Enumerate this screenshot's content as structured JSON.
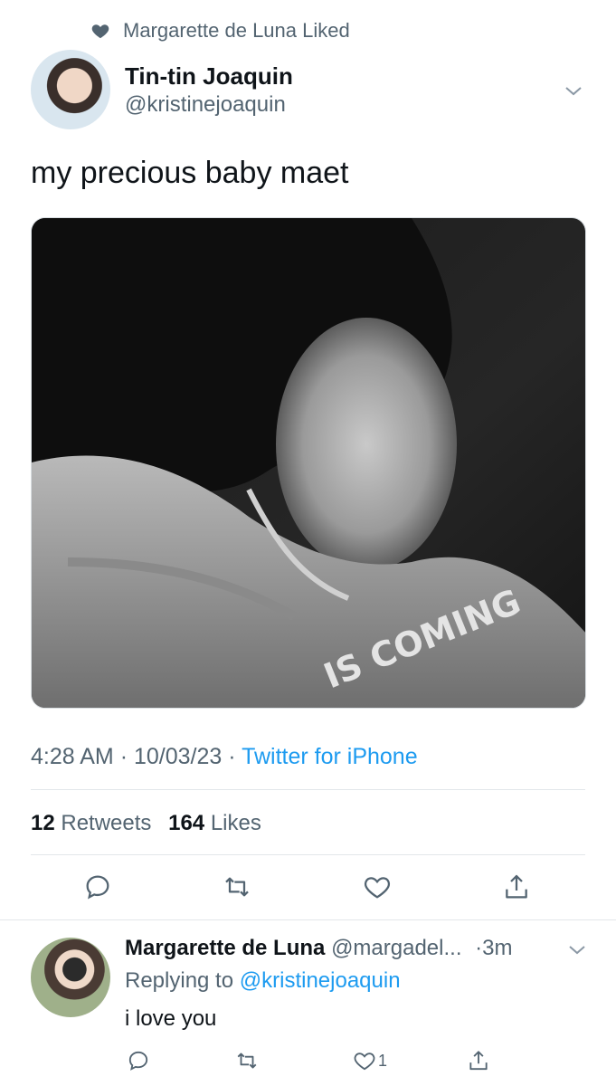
{
  "social_context": {
    "text": "Margarette de Luna Liked",
    "icon": "heart-icon"
  },
  "tweet": {
    "author_name": "Tin-tin Joaquin",
    "author_handle": "@kristinejoaquin",
    "text": "my precious baby maet",
    "media_caption": "IS COMING",
    "time": "4:28 AM",
    "date": "10/03/23",
    "source": "Twitter for iPhone",
    "retweets_count": "12",
    "retweets_label": "Retweets",
    "likes_count": "164",
    "likes_label": "Likes"
  },
  "reply": {
    "author_name": "Margarette de Luna",
    "author_handle": "@margadel...",
    "time": "3m",
    "replying_prefix": "Replying to",
    "replying_to": "@kristinejoaquin",
    "text": "i love you",
    "like_count": "1"
  },
  "colors": {
    "accent": "#1d9bf0",
    "secondary_text": "#536471",
    "primary_text": "#0f1419",
    "divider": "#e3e7ea"
  }
}
